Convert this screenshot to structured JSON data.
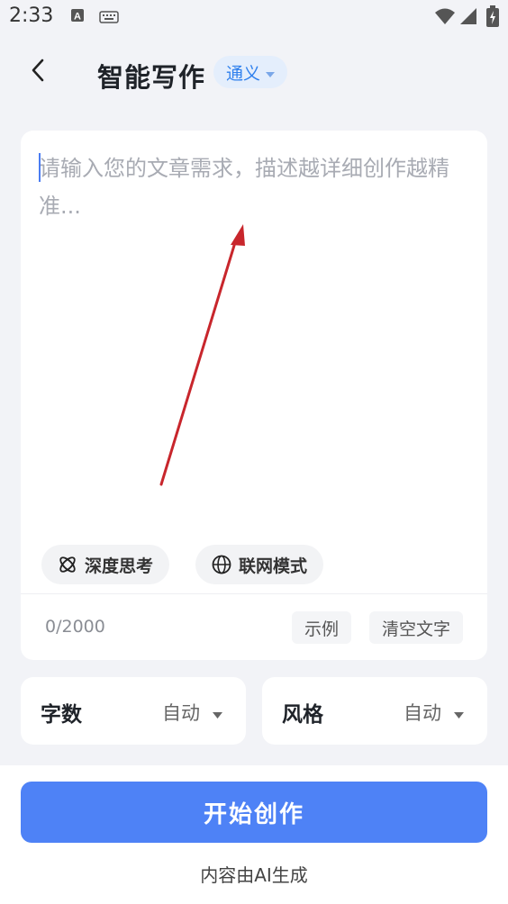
{
  "status_bar": {
    "time": "2:33"
  },
  "header": {
    "title": "智能写作",
    "model": "通义"
  },
  "editor": {
    "placeholder": "请输入您的文章需求，描述越详细创作越精准...",
    "chips": [
      {
        "label": "深度思考"
      },
      {
        "label": "联网模式"
      }
    ],
    "counter": "0/2000",
    "example_label": "示例",
    "clear_label": "清空文字"
  },
  "options": {
    "word_count": {
      "label": "字数",
      "value": "自动"
    },
    "style": {
      "label": "风格",
      "value": "自动"
    }
  },
  "footer": {
    "start_label": "开始创作",
    "note": "内容由AI生成"
  },
  "colors": {
    "accent": "#4e82f6",
    "chip_bg": "#e4eefc",
    "annotation": "#c8262c"
  }
}
